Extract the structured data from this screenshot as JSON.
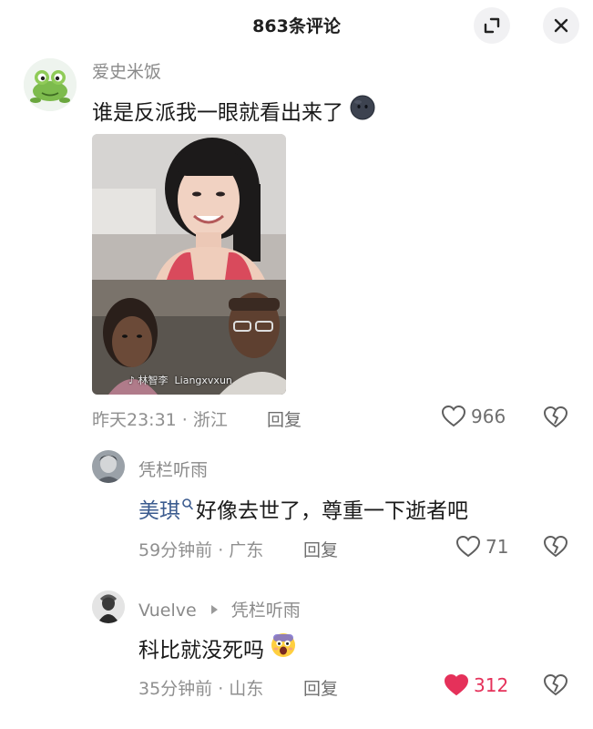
{
  "header": {
    "title": "863条评论"
  },
  "comments": [
    {
      "username": "爱史米饭",
      "text": "谁是反派我一眼就看出来了",
      "emoji": "dark-face-emoji",
      "image": {
        "watermark_account": "林智李",
        "watermark_id": "Liangxvxun"
      },
      "time_location": "昨天23:31 · 浙江",
      "reply_label": "回复",
      "likes": "966",
      "liked": false
    },
    {
      "username": "凭栏听雨",
      "mention": "美琪",
      "text": "好像去世了，尊重一下逝者吧",
      "time_location": "59分钟前 · 广东",
      "reply_label": "回复",
      "likes": "71",
      "liked": false
    },
    {
      "username": "Vuelve",
      "reply_to": "凭栏听雨",
      "text": "科比就没死吗",
      "emoji": "shocked-face-emoji",
      "time_location": "35分钟前 · 山东",
      "reply_label": "回复",
      "likes": "312",
      "liked": true
    }
  ],
  "colors": {
    "liked": "#e5315a",
    "mention": "#3b5b8f",
    "meta": "#8f8f8f"
  }
}
